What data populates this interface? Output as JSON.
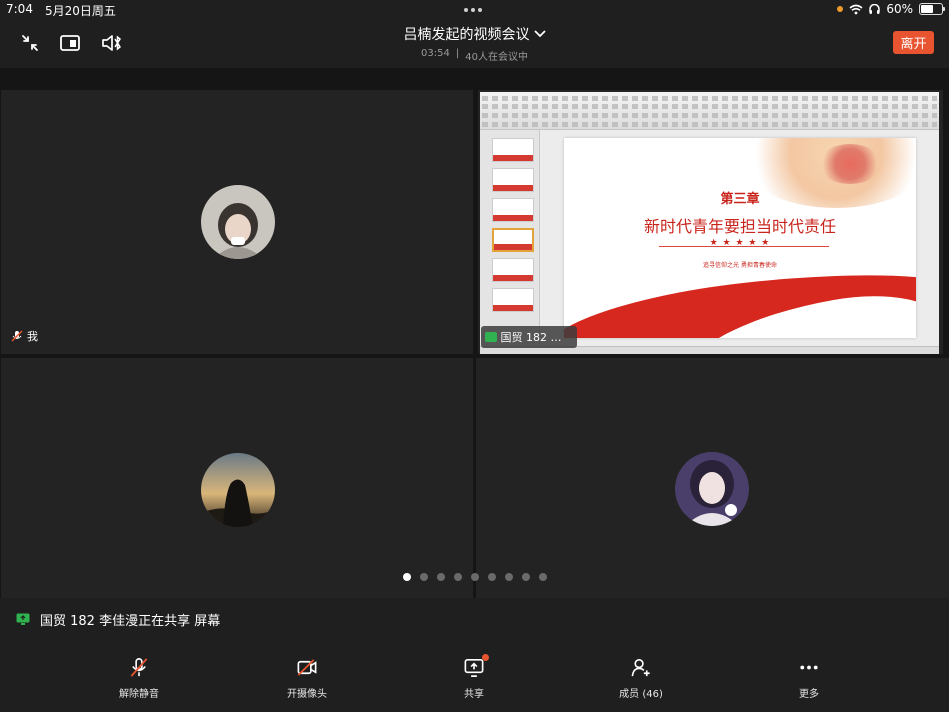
{
  "status_bar": {
    "time": "7:04",
    "date": "5月20日周五",
    "battery": "60%",
    "battery_level": 0.6
  },
  "header": {
    "title": "吕楠发起的视频会议",
    "duration": "03:54",
    "separator": "|",
    "participants_text": "40人在会议中",
    "leave_label": "离开"
  },
  "tiles": {
    "self_label": "我",
    "sharer_label": "国贸 182 李..."
  },
  "slide": {
    "chapter": "第三章",
    "title": "新时代青年要担当时代责任",
    "stars": "★ ★ ★ ★ ★",
    "subtitle": "追寻信仰之光 勇担青春使命"
  },
  "pager": {
    "count": 9,
    "active_index": 0
  },
  "notice": {
    "text": "国贸 182 李佳漫正在共享 屏幕"
  },
  "toolbar": {
    "unmute_label": "解除静音",
    "camera_label": "开摄像头",
    "share_label": "共享",
    "members_label": "成员 (46)",
    "more_label": "更多"
  },
  "colors": {
    "accent_red": "#e8542f",
    "share_green": "#2fb24f",
    "slide_red": "#c9251c"
  }
}
